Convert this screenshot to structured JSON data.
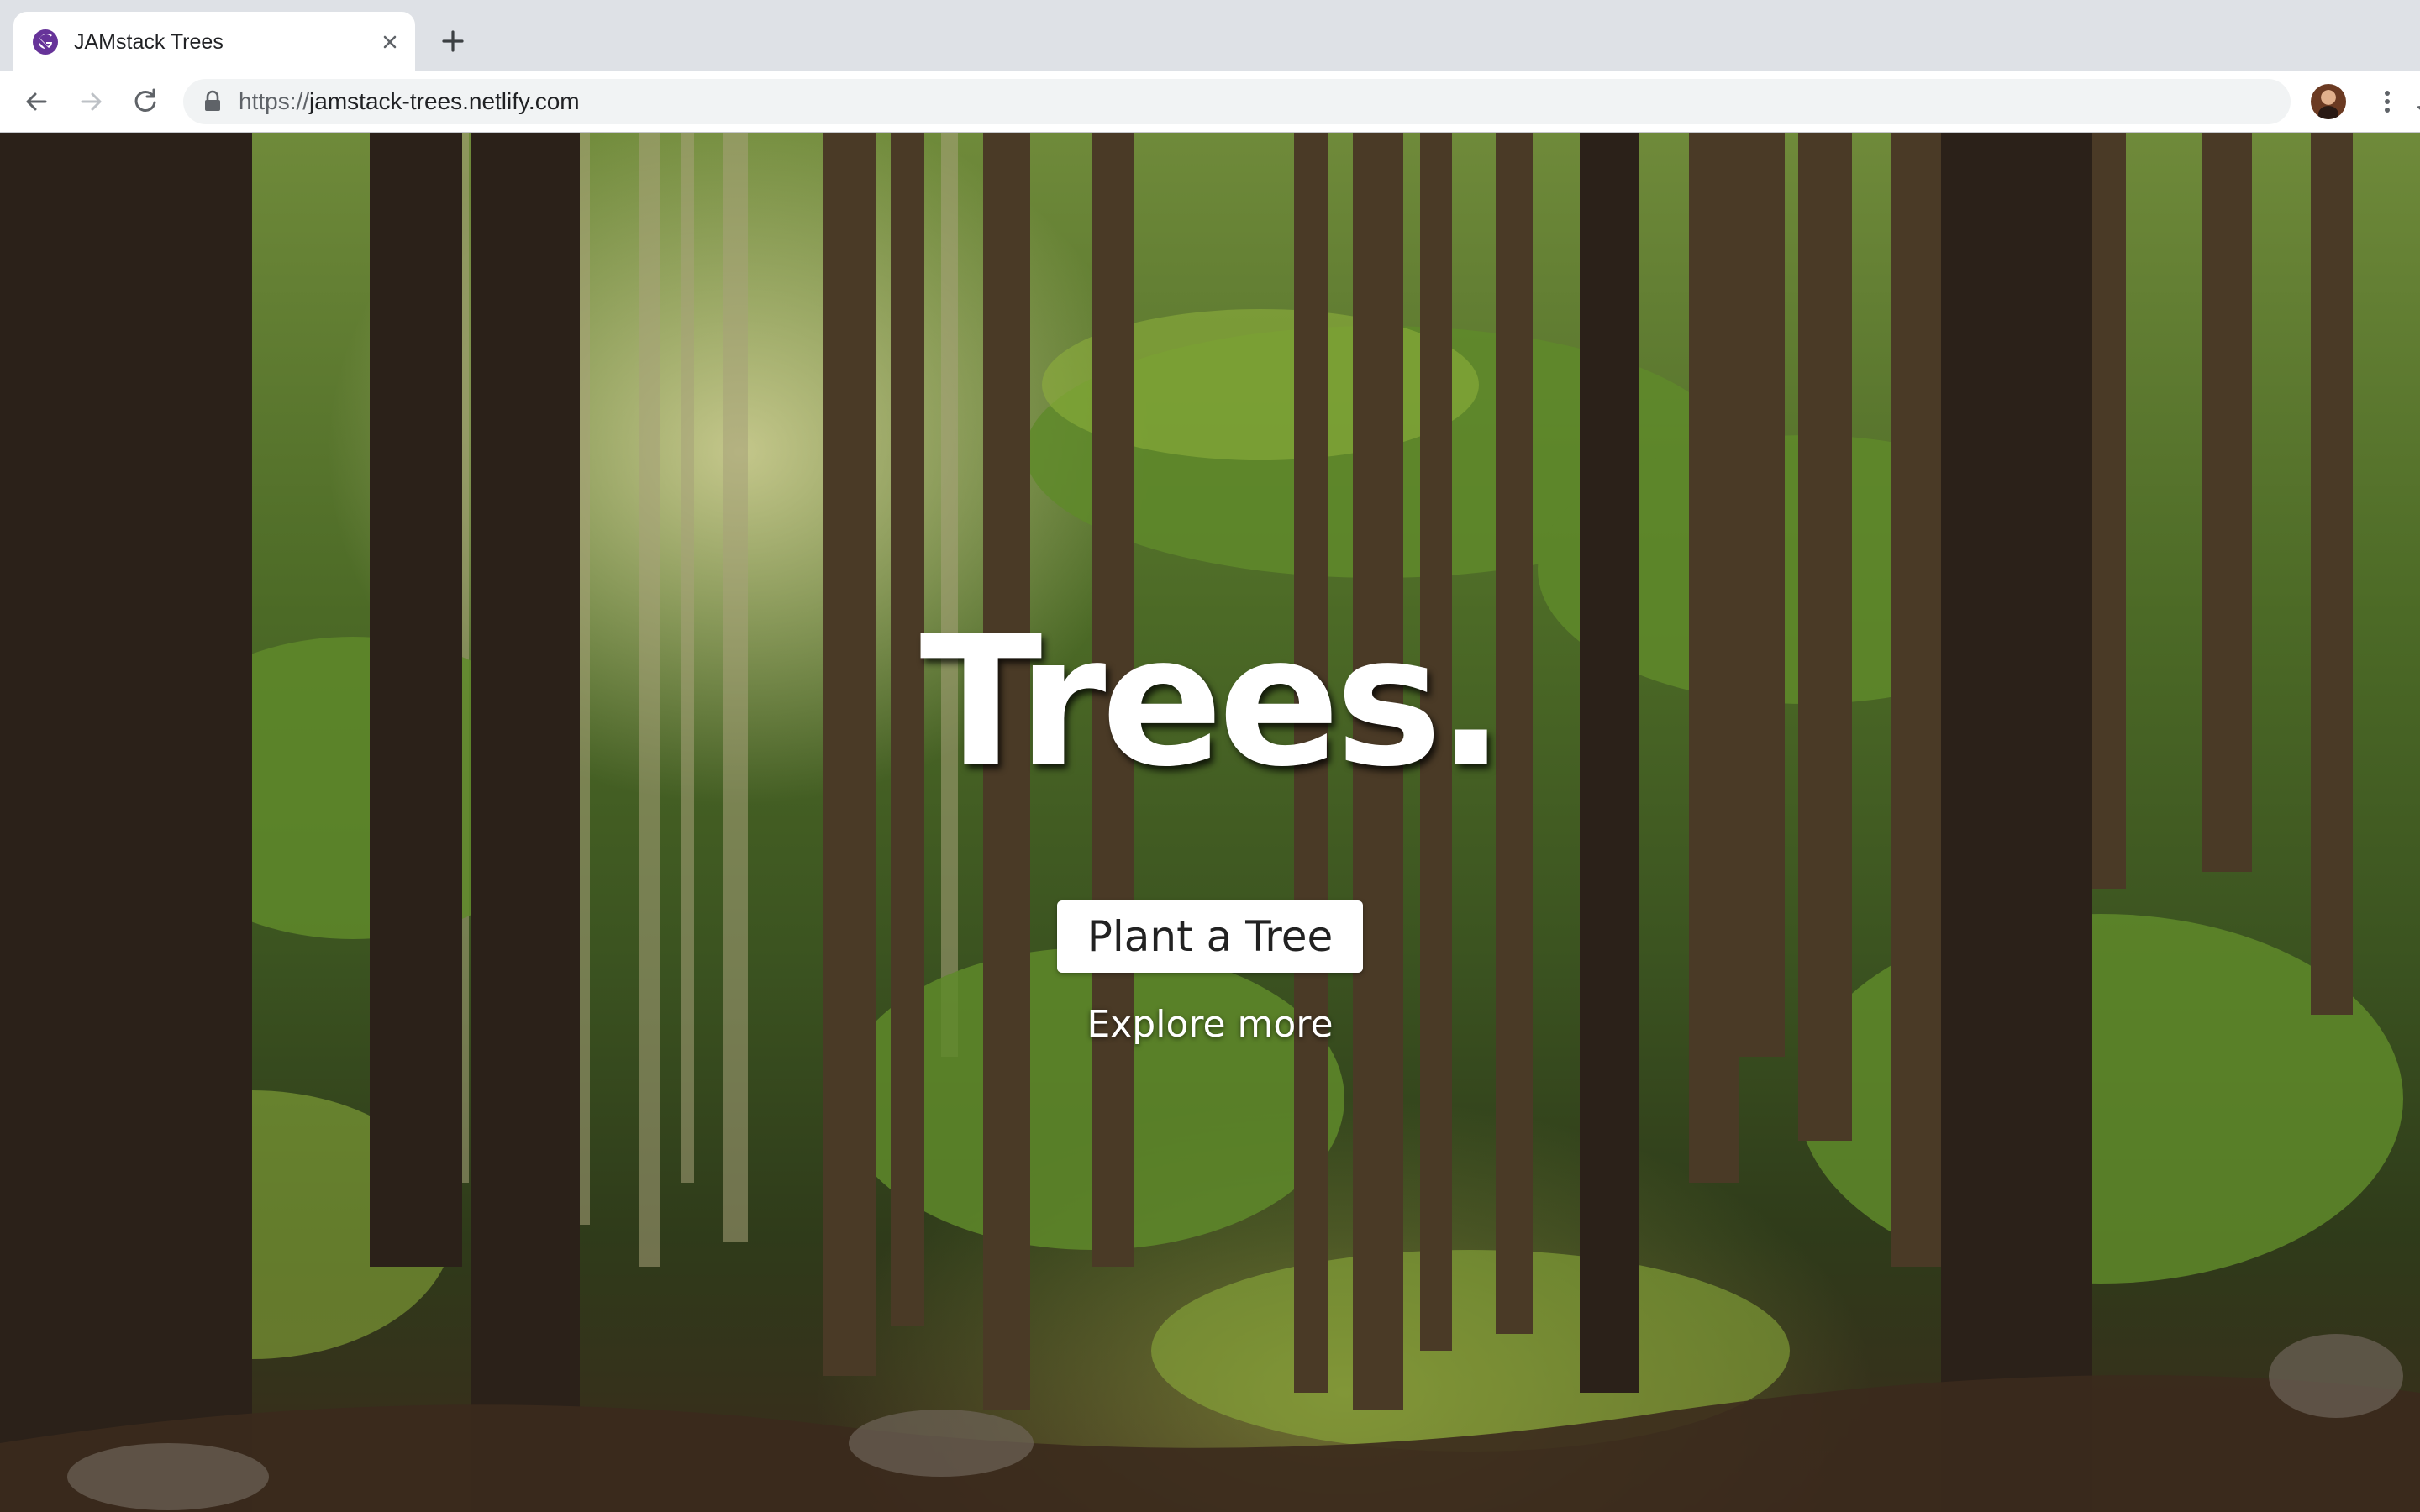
{
  "browser": {
    "tab": {
      "title": "JAMstack Trees",
      "favicon_icon": "gatsby-logo-icon",
      "favicon_color": "#663399"
    },
    "address_bar": {
      "scheme": "https://",
      "host": "jamstack-trees.netlify.com"
    },
    "icons": {
      "back": "arrow-left-icon",
      "forward": "arrow-right-icon",
      "reload": "reload-icon",
      "lock": "lock-icon",
      "bookmark": "star-icon",
      "menu": "more-vertical-icon",
      "new_tab": "plus-icon",
      "close_tab": "close-icon"
    }
  },
  "page": {
    "hero": {
      "title": "Trees.",
      "primary_button": "Plant a Tree",
      "secondary_link": "Explore more"
    }
  }
}
